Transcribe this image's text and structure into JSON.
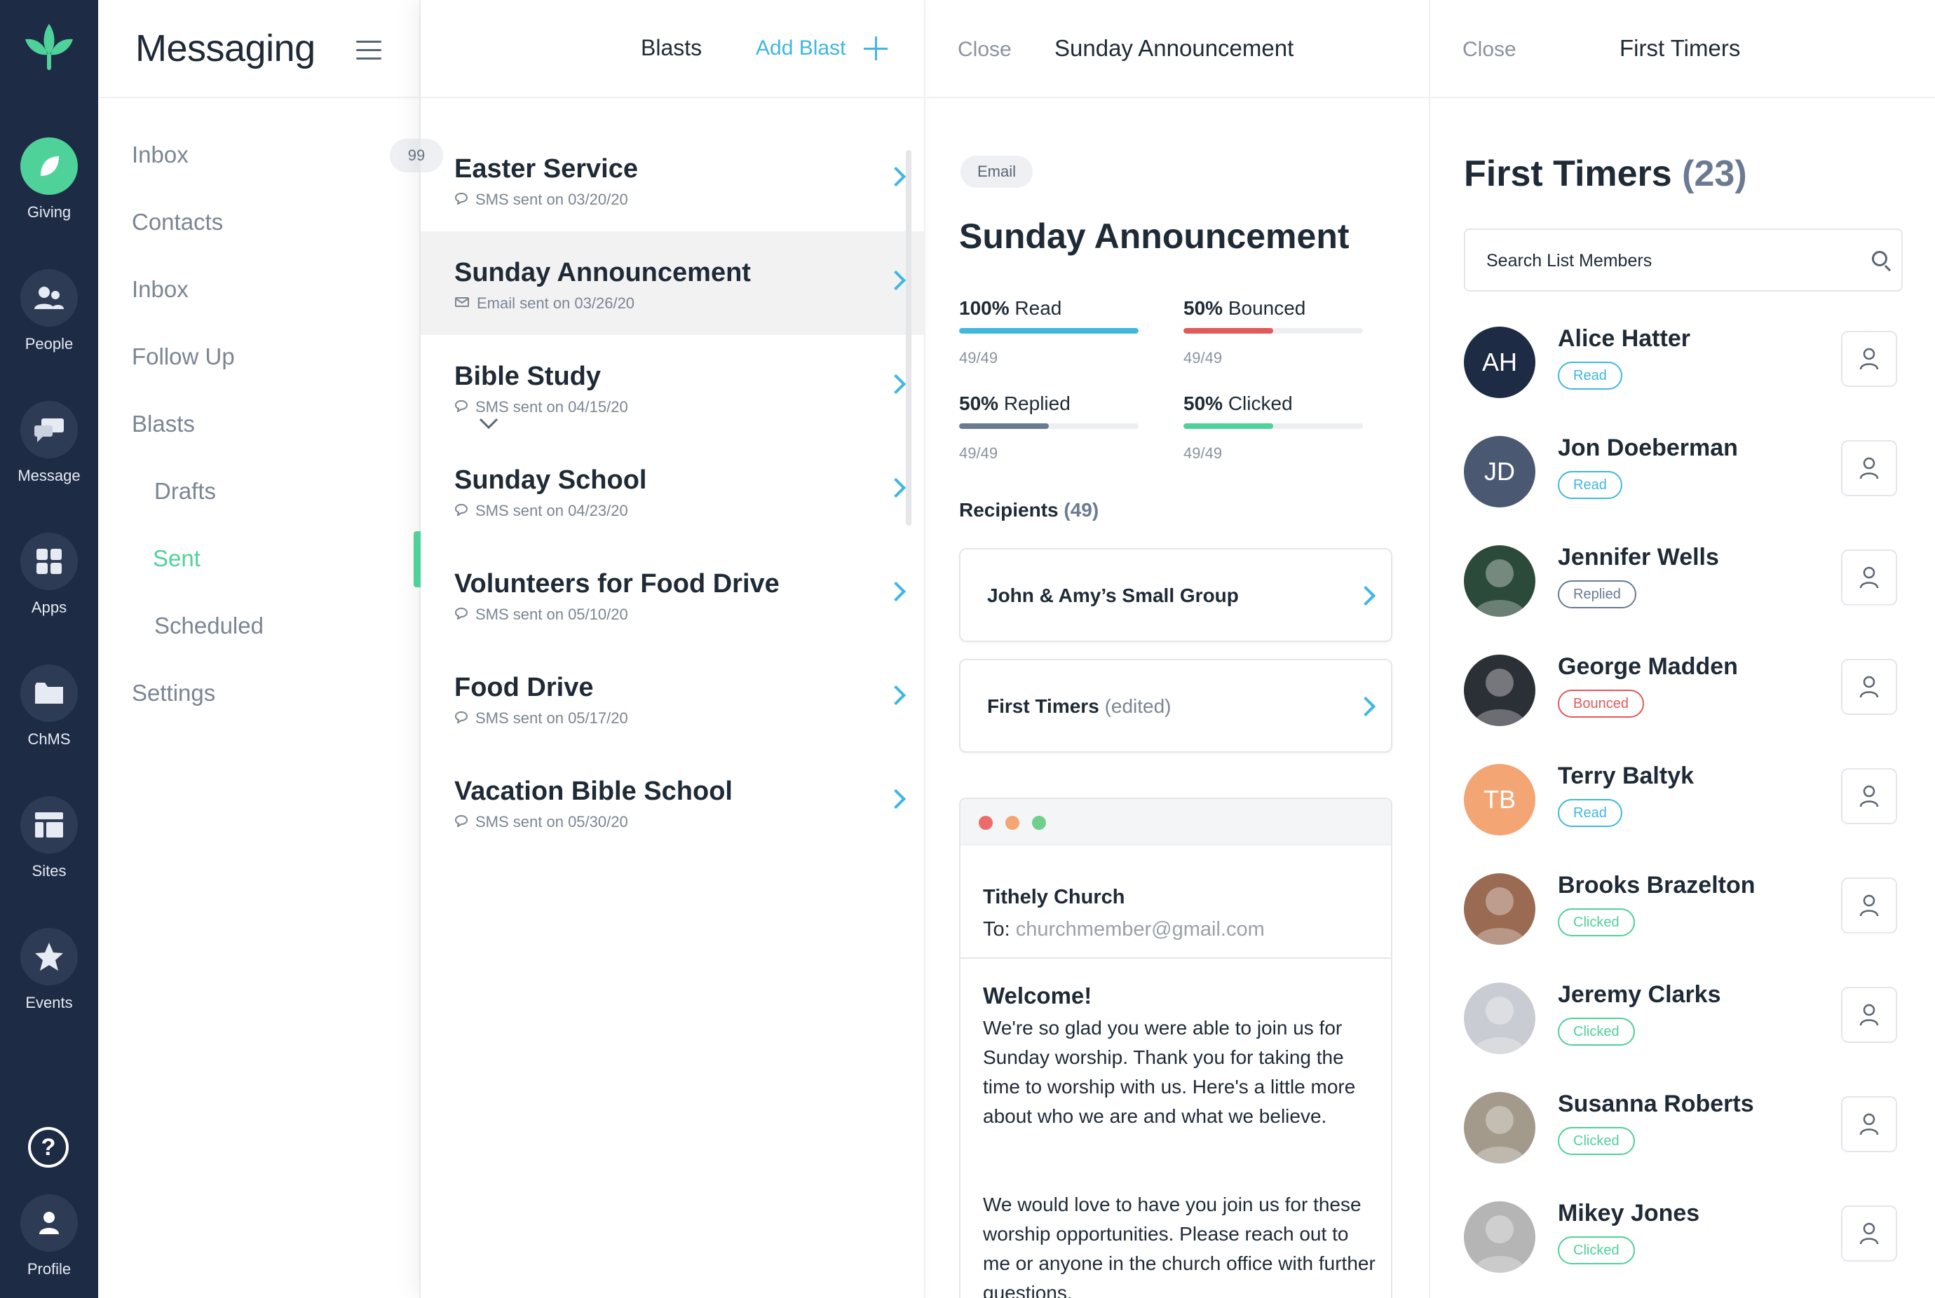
{
  "rail": {
    "items": [
      {
        "label": "Giving",
        "icon": "leaf-icon"
      },
      {
        "label": "People",
        "icon": "people-icon"
      },
      {
        "label": "Message",
        "icon": "chat-icon"
      },
      {
        "label": "Apps",
        "icon": "grid-icon"
      },
      {
        "label": "ChMS",
        "icon": "folder-icon"
      },
      {
        "label": "Sites",
        "icon": "layout-icon"
      },
      {
        "label": "Events",
        "icon": "star-icon"
      }
    ],
    "help_glyph": "?",
    "profile_label": "Profile"
  },
  "nav": {
    "title": "Messaging",
    "inbox_count": "99",
    "items": [
      "Inbox",
      "Contacts",
      "Inbox",
      "Follow Up",
      "Blasts",
      "Drafts",
      "Sent",
      "Scheduled",
      "Settings"
    ]
  },
  "blasts": {
    "title": "Blasts",
    "add_label": "Add Blast",
    "rows": [
      {
        "name": "Easter Service",
        "sub": "SMS sent on 03/20/20",
        "kind": "sms"
      },
      {
        "name": "Sunday Announcement",
        "sub": "Email sent on 03/26/20",
        "kind": "email"
      },
      {
        "name": "Bible Study",
        "sub": "SMS sent on 04/15/20",
        "kind": "sms"
      },
      {
        "name": "Sunday School",
        "sub": "SMS sent on 04/23/20",
        "kind": "sms"
      },
      {
        "name": "Volunteers for Food Drive",
        "sub": "SMS sent on 05/10/20",
        "kind": "sms"
      },
      {
        "name": "Food Drive",
        "sub": "SMS sent on 05/17/20",
        "kind": "sms"
      },
      {
        "name": "Vacation Bible School",
        "sub": "SMS sent on 05/30/20",
        "kind": "sms"
      }
    ]
  },
  "detail": {
    "close_label": "Close",
    "header_title": "Sunday Announcement",
    "chip": "Email",
    "title": "Sunday Announcement",
    "stats": [
      {
        "pct": "100%",
        "label": "Read",
        "count": "49/49",
        "fraction": 1.0,
        "color": "#3fb7e0"
      },
      {
        "pct": "50%",
        "label": "Bounced",
        "count": "49/49",
        "fraction": 0.5,
        "color": "#e05a5a"
      },
      {
        "pct": "50%",
        "label": "Replied",
        "count": "49/49",
        "fraction": 0.5,
        "color": "#6a7a93"
      },
      {
        "pct": "50%",
        "label": "Clicked",
        "count": "49/49",
        "fraction": 0.5,
        "color": "#4fd19a"
      }
    ],
    "recipients_label": "Recipients",
    "recipients_count": "(49)",
    "recipient_cards": [
      {
        "name": "John & Amy’s Small Group",
        "note": ""
      },
      {
        "name": "First Timers",
        "note": "(edited)"
      }
    ],
    "preview": {
      "from": "Tithely Church",
      "to_label": "To:",
      "to_address": "churchmember@gmail.com",
      "heading": "Welcome!",
      "para1": "We're so glad you were able to join us for Sunday worship. Thank you for taking the time to worship with us. Here's a little more about who we are and what we believe.",
      "para2": "We would love to have you join us for these worship opportunities. Please reach out to me or anyone in the church office with further questions."
    }
  },
  "list": {
    "close_label": "Close",
    "header_title": "First Timers",
    "title": "First Timers",
    "count": "(23)",
    "search_placeholder": "Search List Members",
    "members": [
      {
        "name": "Alice Hatter",
        "status": "Read",
        "kind": "read",
        "initials": "AH",
        "color": "#1e2b45",
        "online": true
      },
      {
        "name": "Jon Doeberman",
        "status": "Read",
        "kind": "read",
        "initials": "JD",
        "color": "#4a5872",
        "online": false
      },
      {
        "name": "Jennifer Wells",
        "status": "Replied",
        "kind": "replied",
        "initials": "",
        "color": "#2c4a3a",
        "online": false
      },
      {
        "name": "George Madden",
        "status": "Bounced",
        "kind": "bounced",
        "initials": "",
        "color": "#2b2f36",
        "online": false
      },
      {
        "name": "Terry Baltyk",
        "status": "Read",
        "kind": "read",
        "initials": "TB",
        "color": "#f4a574",
        "online": false
      },
      {
        "name": "Brooks Brazelton",
        "status": "Clicked",
        "kind": "clicked",
        "initials": "",
        "color": "#9a6a52",
        "online": false
      },
      {
        "name": "Jeremy Clarks",
        "status": "Clicked",
        "kind": "clicked",
        "initials": "",
        "color": "#c9ccd2",
        "online": false
      },
      {
        "name": "Susanna Roberts",
        "status": "Clicked",
        "kind": "clicked",
        "initials": "",
        "color": "#a39a8c",
        "online": false
      },
      {
        "name": "Mikey Jones",
        "status": "Clicked",
        "kind": "clicked",
        "initials": "",
        "color": "#b5b5b5",
        "online": false
      }
    ]
  }
}
